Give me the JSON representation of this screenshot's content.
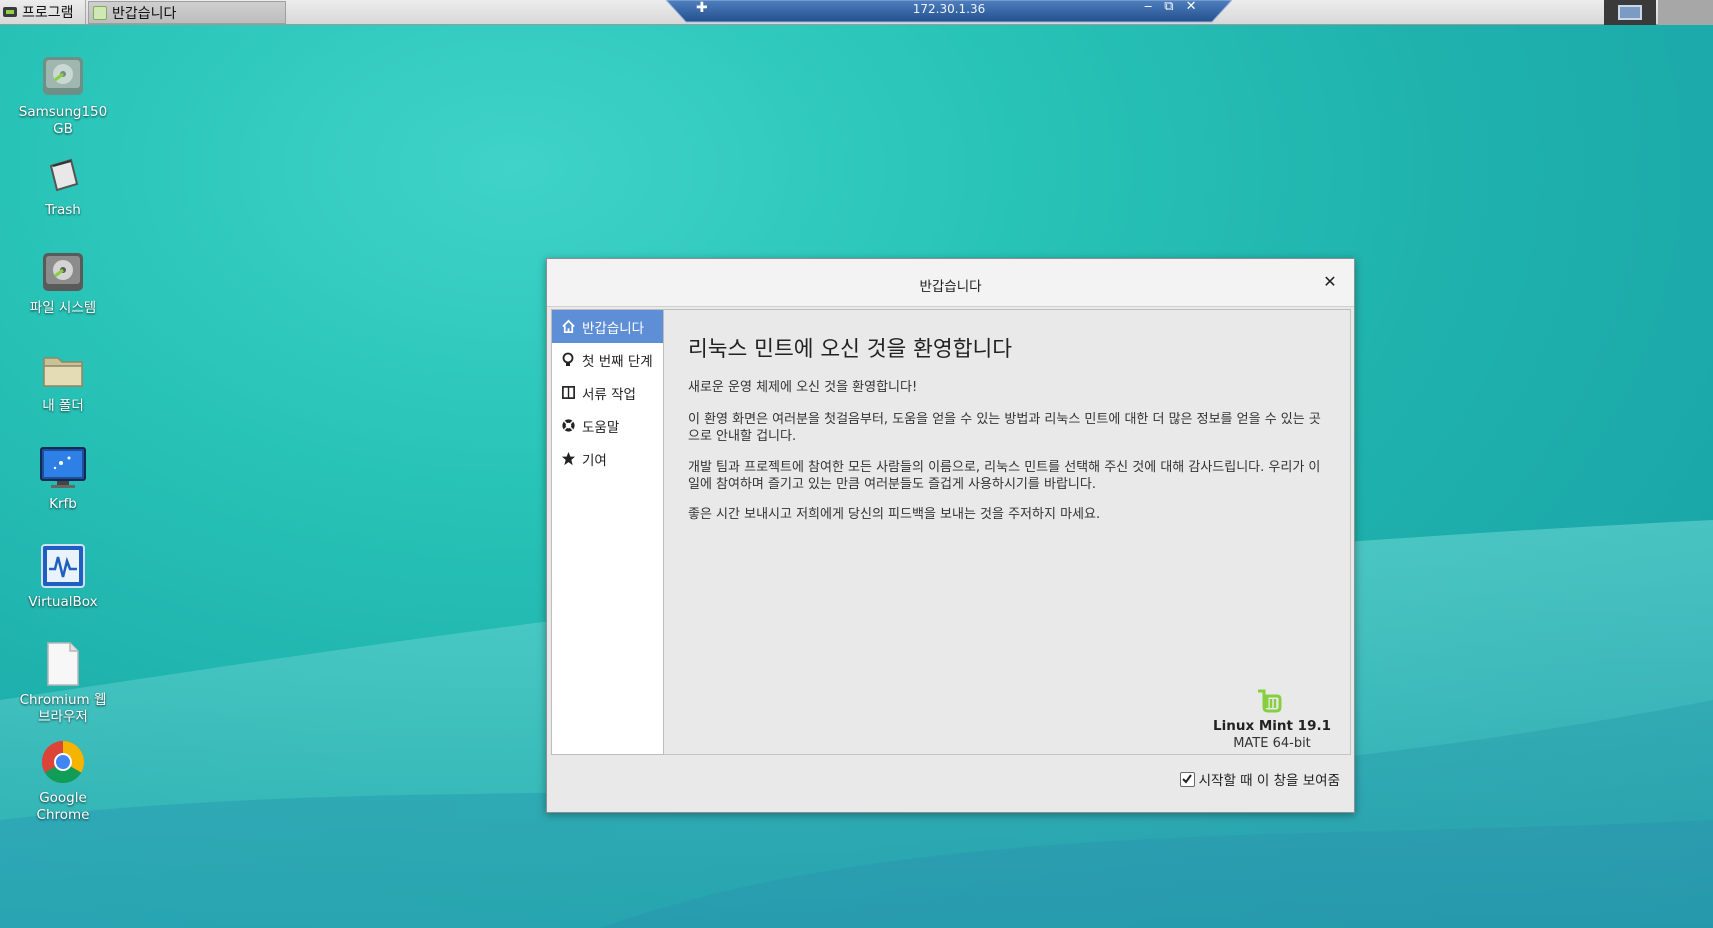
{
  "top_panel": {
    "menu_label": "프로그램",
    "taskbar_item_label": "반갑습니다"
  },
  "remote_bar": {
    "address": "172.30.1.36",
    "pin_glyph": "✚",
    "minimize_glyph": "‒",
    "restore_glyph": "⧉",
    "close_glyph": "✕"
  },
  "desktop_icons": [
    {
      "label_1": "Samsung150",
      "label_2": "GB",
      "icon": "drive-icon"
    },
    {
      "label_1": "Trash",
      "label_2": "",
      "icon": "trash-icon"
    },
    {
      "label_1": "파일 시스템",
      "label_2": "",
      "icon": "filesystem-icon"
    },
    {
      "label_1": "내 폴더",
      "label_2": "",
      "icon": "folder-icon"
    },
    {
      "label_1": "Krfb",
      "label_2": "",
      "icon": "monitor-icon"
    },
    {
      "label_1": "VirtualBox",
      "label_2": "",
      "icon": "virtualbox-icon"
    },
    {
      "label_1": "Chromium 웹",
      "label_2": "브라우저",
      "icon": "document-icon"
    },
    {
      "label_1": "Google",
      "label_2": "Chrome",
      "icon": "chrome-icon"
    }
  ],
  "dialog": {
    "title": "반갑습니다",
    "close_glyph": "✕",
    "sidebar": [
      {
        "label": "반갑습니다",
        "icon": "home-icon",
        "active": true
      },
      {
        "label": "첫 번째 단계",
        "icon": "lightbulb-icon",
        "active": false
      },
      {
        "label": "서류 작업",
        "icon": "book-icon",
        "active": false
      },
      {
        "label": "도움말",
        "icon": "lifebuoy-icon",
        "active": false
      },
      {
        "label": "기여",
        "icon": "star-icon",
        "active": false
      }
    ],
    "heading": "리눅스 민트에 오신 것을 환영합니다",
    "paragraphs": [
      "새로운 운영 체제에 오신 것을 환영합니다!",
      "이 환영 화면은 여러분을 첫걸음부터, 도움을 얻을 수 있는 방법과 리눅스 민트에 대한 더 많은 정보를 얻을 수 있는 곳으로 안내할 겁니다.",
      "개발 팀과 프로젝트에 참여한 모든 사람들의 이름으로, 리눅스 민트를 선택해 주신 것에 대해 감사드립니다. 우리가 이 일에 참여하며 즐기고 있는 만큼 여러분들도 즐겁게 사용하시기를 바랍니다.",
      "좋은 시간 보내시고 저희에게 당신의 피드백을 보내는 것을 주저하지 마세요."
    ],
    "version": "Linux Mint 19.1",
    "edition": "MATE 64-bit",
    "startup_checkbox_label": "시작할 때 이 창을 보여줌",
    "startup_checkbox_checked": true
  },
  "colors": {
    "sidebar_active": "#5e8fd6",
    "mint_green": "#87cf3e",
    "remote_bar": "#2f5f9f"
  }
}
